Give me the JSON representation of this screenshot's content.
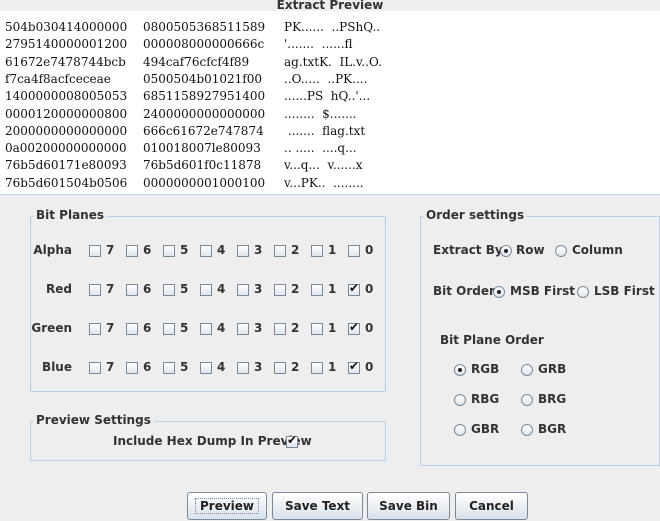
{
  "window": {
    "title": "Extract Preview"
  },
  "preview": {
    "lines": [
      {
        "h1": "504b030414000000",
        "h2": "0800505368511589",
        "a": "PK......  ..PShQ.."
      },
      {
        "h1": "2795140000001200",
        "h2": "000008000000666c",
        "a": "'.......  ......fl"
      },
      {
        "h1": "61672e7478744bcb",
        "h2": "494caf76cfcf4f89",
        "a": "ag.txtK.  IL.v..O."
      },
      {
        "h1": "f7ca4f8acfceceae",
        "h2": "0500504b01021f00",
        "a": "..O.....  ..PK...."
      },
      {
        "h1": "1400000008005053",
        "h2": "6851158927951400",
        "a": "......PS  hQ..'..."
      },
      {
        "h1": "0000120000000800",
        "h2": "2400000000000000",
        "a": "........  $......."
      },
      {
        "h1": "2000000000000000",
        "h2": "666c61672e747874",
        "a": " .......  flag.txt"
      },
      {
        "h1": "0a00200000000000",
        "h2": "010018007le80093",
        "a": ".. .....  ....q..."
      },
      {
        "h1": "76b5d60171e80093",
        "h2": "76b5d601f0c11878",
        "a": "v...q...  v......x"
      },
      {
        "h1": "76b5d601504b0506",
        "h2": "0000000001000100",
        "a": "v...PK..  ........"
      }
    ]
  },
  "bit_planes": {
    "title": "Bit Planes",
    "bits": [
      "7",
      "6",
      "5",
      "4",
      "3",
      "2",
      "1",
      "0"
    ],
    "rows": [
      {
        "label": "Alpha",
        "checked": [
          false,
          false,
          false,
          false,
          false,
          false,
          false,
          false
        ]
      },
      {
        "label": "Red",
        "checked": [
          false,
          false,
          false,
          false,
          false,
          false,
          false,
          true
        ]
      },
      {
        "label": "Green",
        "checked": [
          false,
          false,
          false,
          false,
          false,
          false,
          false,
          true
        ]
      },
      {
        "label": "Blue",
        "checked": [
          false,
          false,
          false,
          false,
          false,
          false,
          false,
          true
        ]
      }
    ]
  },
  "preview_settings": {
    "title": "Preview Settings",
    "include_hex_label": "Include Hex Dump In Preview",
    "include_hex_checked": true
  },
  "order_settings": {
    "title": "Order settings",
    "extract_by_label": "Extract By",
    "extract_by_options": [
      "Row",
      "Column"
    ],
    "extract_by_selected": "Row",
    "bit_order_label": "Bit Order",
    "bit_order_options": [
      "MSB First",
      "LSB First"
    ],
    "bit_order_selected": "MSB First",
    "plane_order_label": "Bit Plane Order",
    "plane_order_options": [
      "RGB",
      "GRB",
      "RBG",
      "BRG",
      "GBR",
      "BGR"
    ],
    "plane_order_selected": "RGB"
  },
  "buttons": {
    "preview": "Preview",
    "save_text": "Save Text",
    "save_bin": "Save Bin",
    "cancel": "Cancel"
  }
}
